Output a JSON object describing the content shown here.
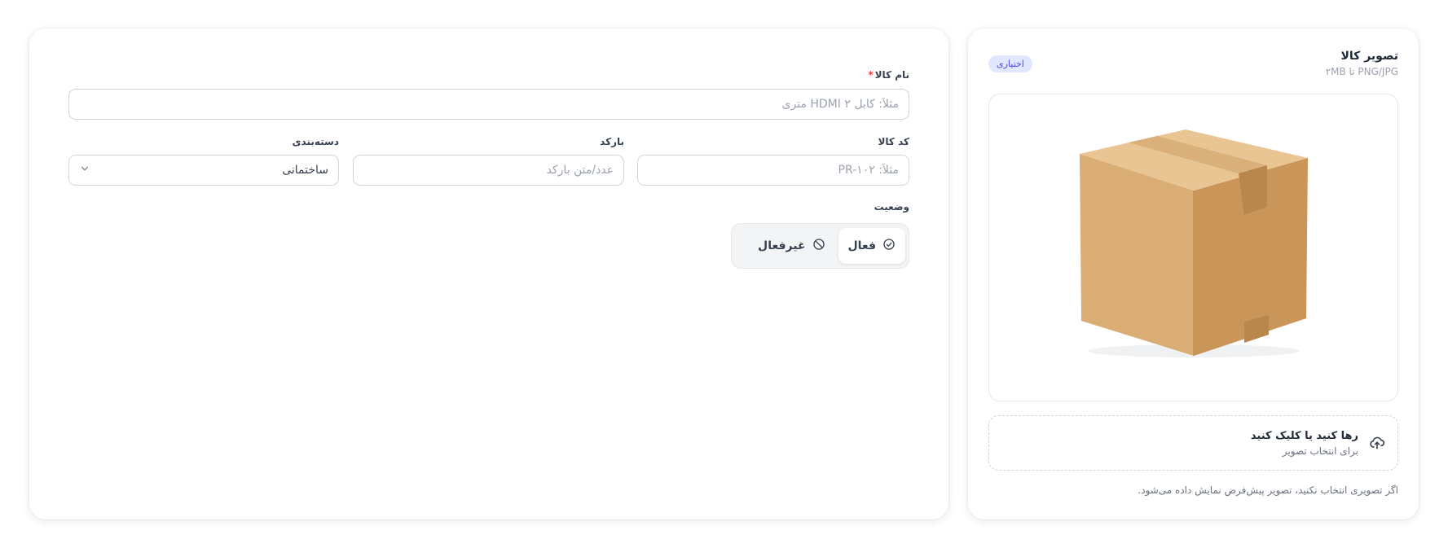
{
  "image_panel": {
    "title": "تصویر کالا",
    "subtitle": "PNG/JPG تا ۲MB",
    "badge": "اختیاری",
    "dropzone_title": "رها کنید یا کلیک کنید",
    "dropzone_subtitle": "برای انتخاب تصویر",
    "note": "اگر تصویری انتخاب نکنید، تصویر پیش‌فرض نمایش داده می‌شود."
  },
  "form": {
    "name": {
      "label": "نام کالا",
      "required_mark": "*",
      "placeholder": "مثلاً: کابل HDMI ۲ متری",
      "value": ""
    },
    "code": {
      "label": "کد کالا",
      "placeholder": "مثلاً: PR-۱۰۲",
      "value": ""
    },
    "barcode": {
      "label": "بارکد",
      "placeholder": "عدد/متن بارکد",
      "value": ""
    },
    "category": {
      "label": "دسته‌بندی",
      "selected": "ساختمانی"
    },
    "status": {
      "label": "وضعیت",
      "active_label": "فعال",
      "inactive_label": "غیرفعال",
      "selected": "active"
    }
  },
  "colors": {
    "accent": "#4f46e5",
    "required": "#ef4444",
    "box": "#d6a96f"
  }
}
